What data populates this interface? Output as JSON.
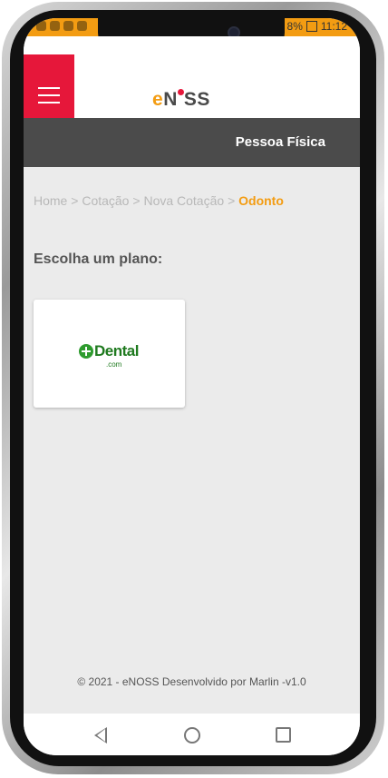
{
  "status_bar": {
    "battery": "8%",
    "time": "11:12"
  },
  "header": {
    "logo_prefix": "e",
    "logo_main": "N",
    "logo_suffix": "SS"
  },
  "title_bar": {
    "title": "Pessoa Física"
  },
  "breadcrumb": {
    "items": [
      "Home",
      "Cotação",
      "Nova Cotação"
    ],
    "separator": ">",
    "active": "Odonto"
  },
  "main": {
    "heading": "Escolha um plano:",
    "plans": [
      {
        "name": "Dental",
        "suffix": ".com",
        "brand_color": "#2e9b2e"
      }
    ]
  },
  "footer": {
    "text": "© 2021 - eNOSS Desenvolvido por Marlin -v1.0"
  },
  "colors": {
    "accent_orange": "#f39c12",
    "accent_red": "#e6173a",
    "title_bar": "#4b4b4b",
    "background": "#ebebeb"
  },
  "icons": {
    "menu": "hamburger-icon",
    "back": "back-triangle-icon",
    "home": "home-circle-icon",
    "recent": "recent-square-icon",
    "plan_logo": "plus-circle-icon"
  }
}
